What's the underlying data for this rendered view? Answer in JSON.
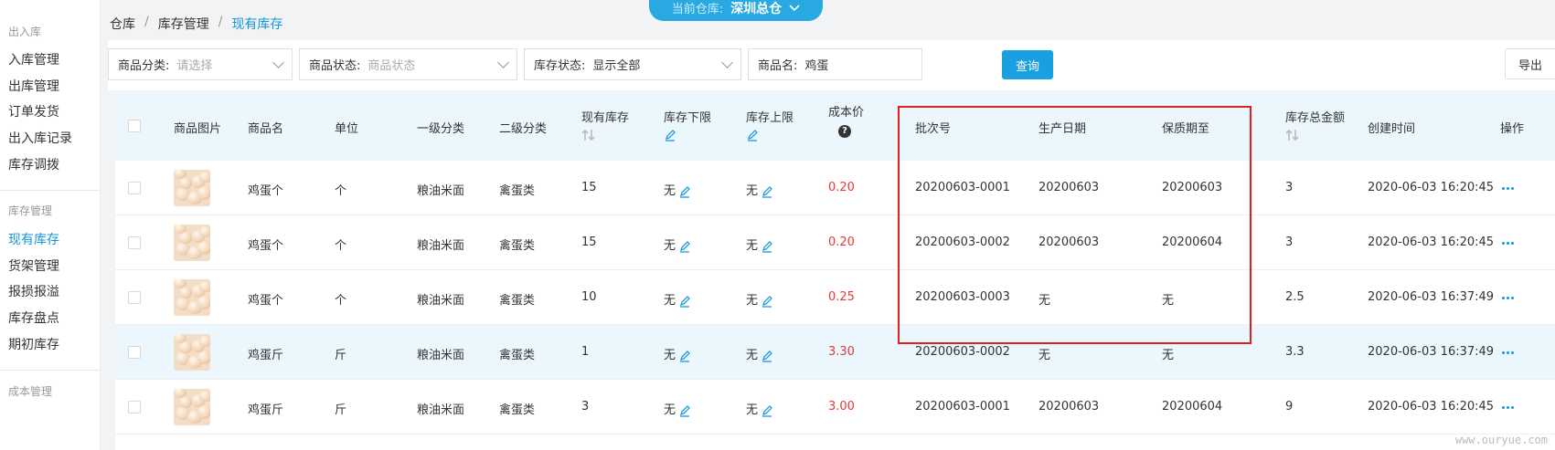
{
  "sidebar": {
    "groups": [
      {
        "label": "出入库",
        "items": [
          "入库管理",
          "出库管理",
          "订单发货",
          "出入库记录",
          "库存调拨"
        ]
      },
      {
        "label": "库存管理",
        "items": [
          "现有库存",
          "货架管理",
          "报损报溢",
          "库存盘点",
          "期初库存"
        ]
      },
      {
        "label": "成本管理",
        "items": []
      }
    ],
    "active_item": "现有库存"
  },
  "breadcrumb": [
    "仓库",
    "库存管理",
    "现有库存"
  ],
  "warehouse": {
    "label": "当前仓库:",
    "value": "深圳总仓"
  },
  "filters": {
    "category": {
      "label": "商品分类:",
      "placeholder": "请选择"
    },
    "status": {
      "label": "商品状态:",
      "placeholder": "商品状态"
    },
    "stock_status": {
      "label": "库存状态:",
      "value": "显示全部"
    },
    "name": {
      "label": "商品名:",
      "value": "鸡蛋"
    },
    "query_button": "查询",
    "export_button": "导出"
  },
  "table": {
    "headers": {
      "image": "商品图片",
      "name": "商品名",
      "unit": "单位",
      "cat1": "一级分类",
      "cat2": "二级分类",
      "stock": "现有库存",
      "lower": "库存下限",
      "upper": "库存上限",
      "cost": "成本价",
      "batch": "批次号",
      "prod_date": "生产日期",
      "expiry": "保质期至",
      "total": "库存总金额",
      "created": "创建时间",
      "ops": "操作"
    },
    "rows": [
      {
        "name": "鸡蛋个",
        "unit": "个",
        "cat1": "粮油米面",
        "cat2": "禽蛋类",
        "stock": "15",
        "lower": "无",
        "upper": "无",
        "cost": "0.20",
        "batch": "20200603-0001",
        "prod_date": "20200603",
        "expiry": "20200603",
        "total": "3",
        "created": "2020-06-03 16:20:45"
      },
      {
        "name": "鸡蛋个",
        "unit": "个",
        "cat1": "粮油米面",
        "cat2": "禽蛋类",
        "stock": "15",
        "lower": "无",
        "upper": "无",
        "cost": "0.20",
        "batch": "20200603-0002",
        "prod_date": "20200603",
        "expiry": "20200604",
        "total": "3",
        "created": "2020-06-03 16:20:45"
      },
      {
        "name": "鸡蛋个",
        "unit": "个",
        "cat1": "粮油米面",
        "cat2": "禽蛋类",
        "stock": "10",
        "lower": "无",
        "upper": "无",
        "cost": "0.25",
        "batch": "20200603-0003",
        "prod_date": "无",
        "expiry": "无",
        "total": "2.5",
        "created": "2020-06-03 16:37:49"
      },
      {
        "name": "鸡蛋斤",
        "unit": "斤",
        "cat1": "粮油米面",
        "cat2": "禽蛋类",
        "stock": "1",
        "lower": "无",
        "upper": "无",
        "cost": "3.30",
        "batch": "20200603-0002",
        "prod_date": "无",
        "expiry": "无",
        "total": "3.3",
        "created": "2020-06-03 16:37:49"
      },
      {
        "name": "鸡蛋斤",
        "unit": "斤",
        "cat1": "粮油米面",
        "cat2": "禽蛋类",
        "stock": "3",
        "lower": "无",
        "upper": "无",
        "cost": "3.00",
        "batch": "20200603-0001",
        "prod_date": "20200603",
        "expiry": "20200604",
        "total": "9",
        "created": "2020-06-03 16:20:45"
      }
    ],
    "highlighted_row": 3
  },
  "watermark": "www.ouryue.com",
  "colors": {
    "accent": "#1296db",
    "price": "#e53935",
    "annotation_box": "#e02020",
    "header_bg": "#ebf7fd"
  }
}
